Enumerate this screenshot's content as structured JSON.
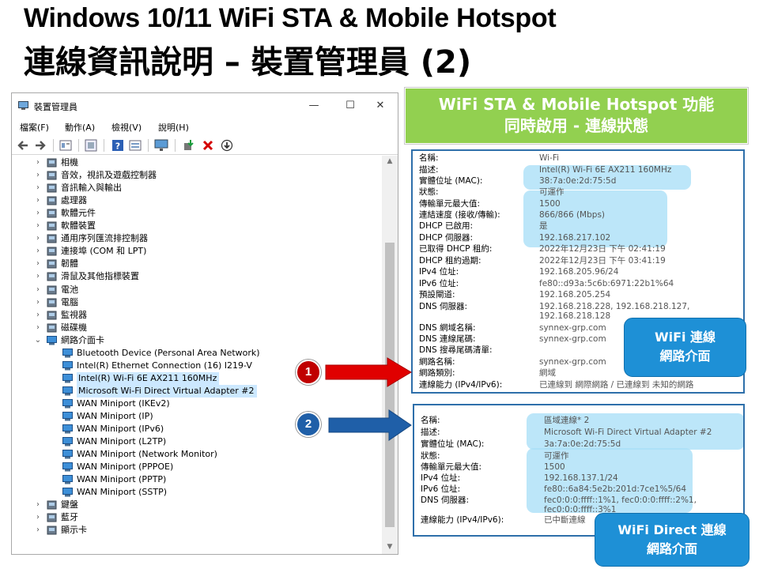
{
  "slide": {
    "title_line1": "Windows 10/11 WiFi STA & Mobile Hotspot",
    "title_line2": "連線資訊說明 – 裝置管理員 (2)"
  },
  "window": {
    "title": "裝置管理員",
    "controls": {
      "minimize": "—",
      "maximize": "☐",
      "close": "✕"
    },
    "menu": [
      "檔案(F)",
      "動作(A)",
      "檢視(V)",
      "說明(H)"
    ],
    "toolbar_icons": [
      "back-arrow-icon",
      "forward-arrow-icon",
      "properties-icon",
      "update-driver-icon",
      "help-icon",
      "view-icon",
      "monitor-icon",
      "add-driver-icon",
      "uninstall-icon",
      "download-icon"
    ],
    "tree": {
      "categories": [
        "相機",
        "音效，視訊及遊戲控制器",
        "音訊輸入與輸出",
        "處理器",
        "軟體元件",
        "軟體裝置",
        "通用序列匯流排控制器",
        "連接埠 (COM 和 LPT)",
        "韌體",
        "滑鼠及其他指標裝置",
        "電池",
        "電腦",
        "監視器",
        "磁碟機",
        "網路介面卡"
      ],
      "network_adapters": [
        "Bluetooth Device (Personal Area Network)",
        "Intel(R) Ethernet Connection (16) I219-V",
        "Intel(R) Wi-Fi 6E AX211 160MHz",
        "Microsoft Wi-Fi Direct Virtual Adapter #2",
        "WAN Miniport (IKEv2)",
        "WAN Miniport (IP)",
        "WAN Miniport (IPv6)",
        "WAN Miniport (L2TP)",
        "WAN Miniport (Network Monitor)",
        "WAN Miniport (PPPOE)",
        "WAN Miniport (PPTP)",
        "WAN Miniport (SSTP)"
      ],
      "after": [
        "鍵盤",
        "藍牙",
        "顯示卡"
      ]
    }
  },
  "banner": {
    "line1": "WiFi STA & Mobile Hotspot 功能",
    "line2": "同時啟用 - 連線狀態"
  },
  "wifi_panel": {
    "rows": [
      {
        "label": "名稱:",
        "value": "Wi-Fi"
      },
      {
        "label": "描述:",
        "value": "Intel(R) Wi-Fi 6E AX211 160MHz"
      },
      {
        "label": "實體位址 (MAC):",
        "value": "38:7a:0e:2d:75:5d"
      },
      {
        "label": "狀態:",
        "value": "可運作"
      },
      {
        "label": "傳輸單元最大值:",
        "value": "1500"
      },
      {
        "label": "連結速度 (接收/傳輸):",
        "value": "866/866 (Mbps)"
      },
      {
        "label": "DHCP 已啟用:",
        "value": "是"
      },
      {
        "label": "DHCP 伺服器:",
        "value": "192.168.217.102"
      },
      {
        "label": "已取得 DHCP 租約:",
        "value": "2022年12月23日 下午 02:41:19"
      },
      {
        "label": "DHCP 租約過期:",
        "value": "2022年12月23日 下午 03:41:19"
      },
      {
        "label": "IPv4 位址:",
        "value": "192.168.205.96/24"
      },
      {
        "label": "IPv6 位址:",
        "value": "fe80::d93a:5c6b:6971:22b1%64"
      },
      {
        "label": "預設閘道:",
        "value": "192.168.205.254"
      },
      {
        "label": "DNS 伺服器:",
        "value": "192.168.218.228, 192.168.218.127,",
        "value2": "192.168.218.128"
      },
      {
        "label": "DNS 網域名稱:",
        "value": "synnex-grp.com"
      },
      {
        "label": "DNS 連線尾碼:",
        "value": "synnex-grp.com"
      },
      {
        "label": "DNS 搜尋尾碼清單:",
        "value": ""
      },
      {
        "label": "網路名稱:",
        "value": "synnex-grp.com"
      },
      {
        "label": "網路類別:",
        "value": "網域"
      },
      {
        "label": "連線能力 (IPv4/IPv6):",
        "value": "已連線到 網際網路 / 已連線到 未知的網路"
      }
    ]
  },
  "direct_panel": {
    "rows": [
      {
        "label": "名稱:",
        "value": "區域連線* 2"
      },
      {
        "label": "描述:",
        "value": "Microsoft Wi-Fi Direct Virtual Adapter #2"
      },
      {
        "label": "實體位址 (MAC):",
        "value": "3a:7a:0e:2d:75:5d"
      },
      {
        "label": "狀態:",
        "value": "可運作"
      },
      {
        "label": "傳輸單元最大值:",
        "value": "1500"
      },
      {
        "label": "IPv4 位址:",
        "value": "192.168.137.1/24"
      },
      {
        "label": "IPv6 位址:",
        "value": "fe80::6a84:5e2b:201d:7ce1%5/64"
      },
      {
        "label": "DNS 伺服器:",
        "value": "fec0:0:0:ffff::1%1, fec0:0:0:ffff::2%1,",
        "value2": "fec0:0:0:ffff::3%1"
      },
      {
        "label": "連線能力 (IPv4/IPv6):",
        "value": "已中斷連線"
      }
    ]
  },
  "callouts": {
    "wifi": {
      "line1": "WiFi 連線",
      "line2": "網路介面"
    },
    "direct": {
      "line1": "WiFi Direct 連線",
      "line2": "網路介面"
    }
  },
  "markers": {
    "one": "1",
    "two": "2"
  },
  "colors": {
    "banner_green": "#92d050",
    "panel_border": "#2e6faa",
    "callout_blue": "#1e90d6",
    "highlight": "#a9dff7",
    "arrow_red": "#e00000",
    "arrow_blue": "#1f5fa8"
  }
}
